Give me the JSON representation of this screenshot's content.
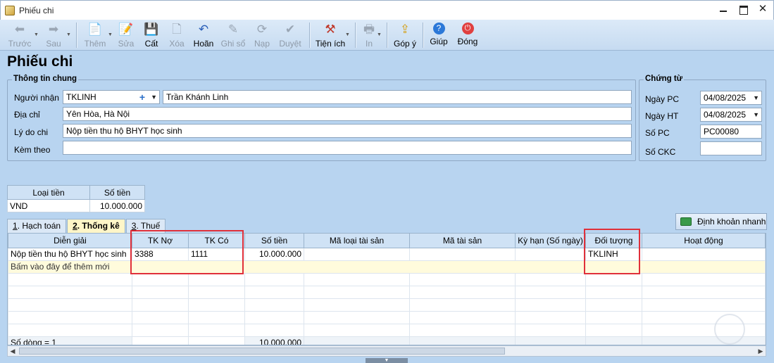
{
  "window": {
    "title": "Phiếu chi"
  },
  "toolbar": {
    "prev": "Trước",
    "next": "Sau",
    "add": "Thêm",
    "edit": "Sửa",
    "save": "Cất",
    "delete": "Xóa",
    "undo": "Hoãn",
    "post": "Ghi sổ",
    "reload": "Nạp",
    "approve": "Duyệt",
    "utility": "Tiện ích",
    "print": "In",
    "feedback": "Góp ý",
    "help": "Giúp",
    "close": "Đóng"
  },
  "page": {
    "heading": "Phiếu chi"
  },
  "general": {
    "group_title": "Thông tin chung",
    "recipient_label": "Người nhận",
    "recipient_code": "TKLINH",
    "recipient_name": "Trần Khánh Linh",
    "address_label": "Địa chỉ",
    "address": "Yên Hòa, Hà Nội",
    "reason_label": "Lý do chi",
    "reason": "Nộp tiền thu hộ BHYT học sinh",
    "attach_label": "Kèm theo",
    "attach": ""
  },
  "voucher": {
    "group_title": "Chứng từ",
    "pc_date_label": "Ngày PC",
    "pc_date": "04/08/2025",
    "ht_date_label": "Ngày HT",
    "ht_date": "04/08/2025",
    "number_label": "Số PC",
    "number": "PC00080",
    "ckc_label": "Số CKC",
    "ckc": ""
  },
  "money": {
    "currency_header": "Loại tiền",
    "amount_header": "Số tiền",
    "currency": "VND",
    "amount": "10.000.000"
  },
  "tabs": [
    {
      "key": "1",
      "label": ". Hạch toán"
    },
    {
      "key": "2",
      "label": ". Thống kê"
    },
    {
      "key": "3",
      "label": ". Thuế"
    }
  ],
  "quick_entry": "Định khoản nhanh",
  "grid": {
    "columns": [
      "Diễn giải",
      "TK Nợ",
      "TK Có",
      "Số tiền",
      "Mã loại tài sản",
      "Mã tài sản",
      "Kỳ hạn (Số ngày)",
      "Đối tượng",
      "Hoạt động"
    ],
    "row": {
      "desc": "Nộp tiền thu hộ BHYT học sinh",
      "debit": "3388",
      "credit": "1111",
      "amount": "10.000.000",
      "object": "TKLINH"
    },
    "add_row": "Bấm vào đây để thêm mới",
    "row_count": "Số dòng = 1",
    "total": "10.000.000"
  }
}
